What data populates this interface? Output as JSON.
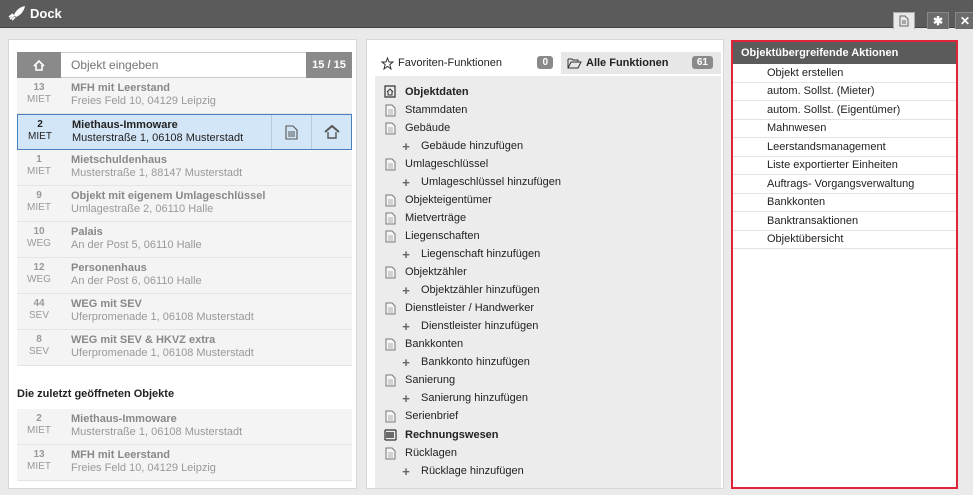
{
  "window": {
    "title": "Dock"
  },
  "search": {
    "placeholder": "Objekt eingeben",
    "count": "15 / 15"
  },
  "objects": [
    {
      "num": "13",
      "type": "MIET",
      "name": "MFH mit Leerstand",
      "addr": "Freies Feld 10, 04129 Leipzig"
    },
    {
      "num": "2",
      "type": "MIET",
      "name": "Miethaus-Immoware",
      "addr": "Musterstraße 1, 06108 Musterstadt",
      "active": true
    },
    {
      "num": "1",
      "type": "MIET",
      "name": "Mietschuldenhaus",
      "addr": "Musterstraße 1, 88147 Musterstadt"
    },
    {
      "num": "9",
      "type": "MIET",
      "name": "Objekt mit eigenem Umlageschlüssel",
      "addr": "Umlagestraße 2, 06110 Halle"
    },
    {
      "num": "10",
      "type": "WEG",
      "name": "Palais",
      "addr": "An der Post 5, 06110 Halle"
    },
    {
      "num": "12",
      "type": "WEG",
      "name": "Personenhaus",
      "addr": "An der Post 6, 06110 Halle"
    },
    {
      "num": "44",
      "type": "SEV",
      "name": "WEG mit SEV",
      "addr": "Uferpromenade 1, 06108 Musterstadt"
    },
    {
      "num": "8",
      "type": "SEV",
      "name": "WEG mit SEV & HKVZ extra",
      "addr": "Uferpromenade 1, 06108 Musterstadt"
    }
  ],
  "recent": {
    "title": "Die zuletzt geöffneten Objekte",
    "items": [
      {
        "num": "2",
        "type": "MIET",
        "name": "Miethaus-Immoware",
        "addr": "Musterstraße 1, 06108 Musterstadt"
      },
      {
        "num": "13",
        "type": "MIET",
        "name": "MFH mit Leerstand",
        "addr": "Freies Feld 10, 04129 Leipzig"
      }
    ]
  },
  "tabs": {
    "favorites": {
      "label": "Favoriten-Funktionen",
      "count": "0"
    },
    "all": {
      "label": "Alle Funktionen",
      "count": "61"
    }
  },
  "functions": [
    {
      "kind": "section",
      "icon": "home-doc-icon",
      "label": "Objektdaten"
    },
    {
      "kind": "item",
      "label": "Stammdaten"
    },
    {
      "kind": "item",
      "label": "Gebäude"
    },
    {
      "kind": "add",
      "label": "Gebäude hinzufügen"
    },
    {
      "kind": "item",
      "label": "Umlageschlüssel"
    },
    {
      "kind": "add",
      "label": "Umlageschlüssel hinzufügen"
    },
    {
      "kind": "item",
      "label": "Objekteigentümer"
    },
    {
      "kind": "item",
      "label": "Mietverträge"
    },
    {
      "kind": "item",
      "label": "Liegenschaften"
    },
    {
      "kind": "add",
      "label": "Liegenschaft hinzufügen"
    },
    {
      "kind": "item",
      "label": "Objektzähler"
    },
    {
      "kind": "add",
      "label": "Objektzähler hinzufügen"
    },
    {
      "kind": "item",
      "label": "Dienstleister / Handwerker"
    },
    {
      "kind": "add",
      "label": "Dienstleister hinzufügen"
    },
    {
      "kind": "item",
      "label": "Bankkonten"
    },
    {
      "kind": "add",
      "label": "Bankkonto hinzufügen"
    },
    {
      "kind": "item",
      "label": "Sanierung"
    },
    {
      "kind": "add",
      "label": "Sanierung hinzufügen"
    },
    {
      "kind": "item",
      "label": "Serienbrief"
    },
    {
      "kind": "section",
      "icon": "abacus-icon",
      "label": "Rechnungswesen"
    },
    {
      "kind": "item",
      "label": "Rücklagen"
    },
    {
      "kind": "add",
      "label": "Rücklage hinzufügen"
    }
  ],
  "right_panel": {
    "title": "Objektübergreifende Aktionen",
    "actions": [
      "Objekt erstellen",
      "autom. Sollst. (Mieter)",
      "autom. Sollst. (Eigentümer)",
      "Mahnwesen",
      "Leerstandsmanagement",
      "Liste exportierter Einheiten",
      "Auftrags- Vorgangsverwaltung",
      "Bankkonten",
      "Banktransaktionen",
      "Objektübersicht"
    ]
  },
  "colors": {
    "titlebar": "#5b5b5b",
    "highlight_border": "#e0243a",
    "active_row": "#d3e6f7"
  }
}
